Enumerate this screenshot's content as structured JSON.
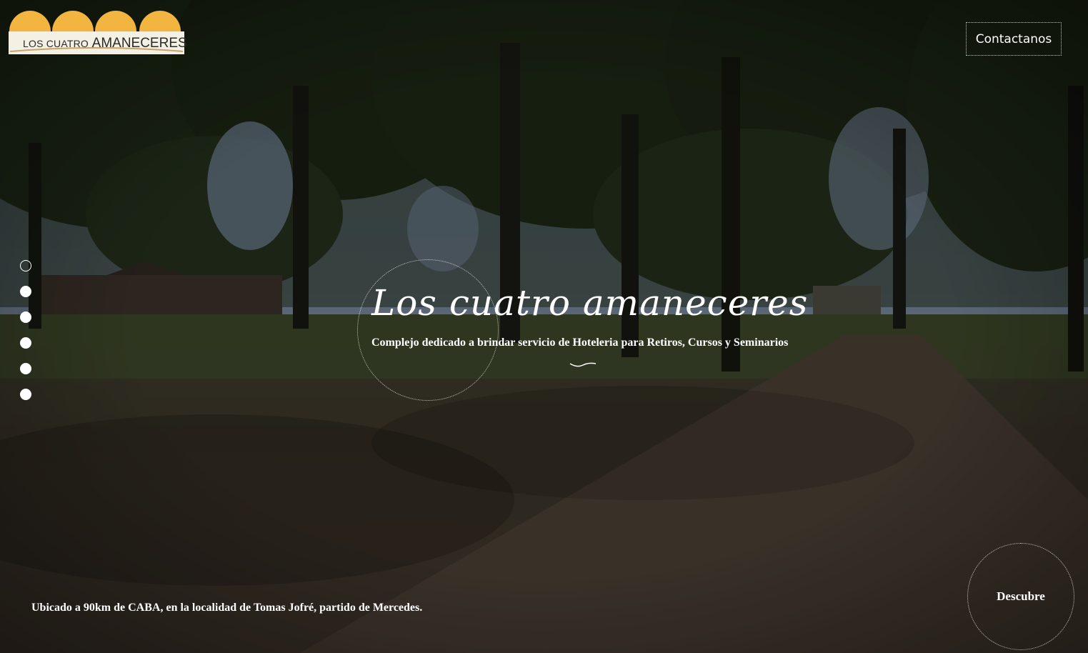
{
  "header": {
    "logo_small": "LOS CUATRO",
    "logo_big": "AMANECERES",
    "contact_label": "Contactanos"
  },
  "slider": {
    "dot_count": 6,
    "active_index": 0
  },
  "hero": {
    "title": "Los cuatro amaneceres",
    "subtitle": "Complejo dedicado a brindar servicio de Hoteleria para Retiros, Cursos y Seminarios"
  },
  "footer": {
    "location_text": "Ubicado a 90km de CABA, en la localidad de Tomas Jofré, partido de Mercedes.",
    "discover_label": "Descubre"
  },
  "colors": {
    "logo_sun": "#f2b640",
    "text": "#ffffff",
    "foliage": "#1f2a17",
    "sky": "#7d8fa5",
    "road": "#4a3f34"
  }
}
